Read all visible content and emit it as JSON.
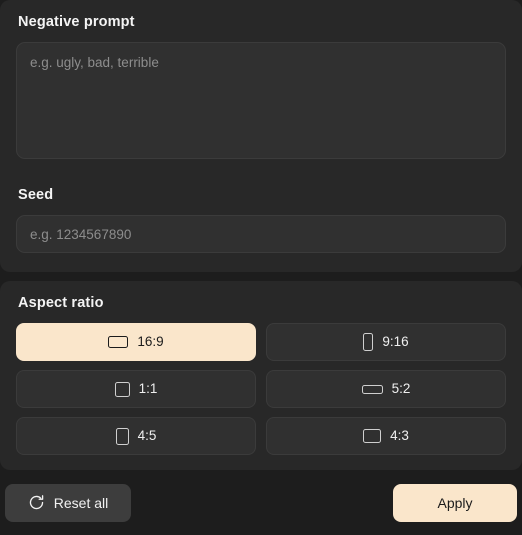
{
  "theme": {
    "page_bg": "#1d1d1d",
    "panel_bg": "#282828",
    "field_bg": "#303030",
    "accent": "#fae6cb",
    "text": "#f4f4f4",
    "muted_text": "#8d8d8d"
  },
  "negative_prompt": {
    "label": "Negative prompt",
    "value": "",
    "placeholder": "e.g. ugly, bad, terrible"
  },
  "seed": {
    "label": "Seed",
    "value": "",
    "placeholder": "e.g. 1234567890"
  },
  "aspect_ratio": {
    "label": "Aspect ratio",
    "selected": "16:9",
    "options": [
      {
        "label": "16:9",
        "icon": "rectangle-landscape-wide-icon",
        "selected": true
      },
      {
        "label": "9:16",
        "icon": "rectangle-portrait-tall-icon",
        "selected": false
      },
      {
        "label": "1:1",
        "icon": "square-icon",
        "selected": false
      },
      {
        "label": "5:2",
        "icon": "rectangle-landscape-ultrawide-icon",
        "selected": false
      },
      {
        "label": "4:5",
        "icon": "rectangle-portrait-icon",
        "selected": false
      },
      {
        "label": "4:3",
        "icon": "rectangle-landscape-icon",
        "selected": false
      }
    ]
  },
  "footer": {
    "reset_label": "Reset all",
    "reset_icon": "refresh-icon",
    "apply_label": "Apply"
  }
}
